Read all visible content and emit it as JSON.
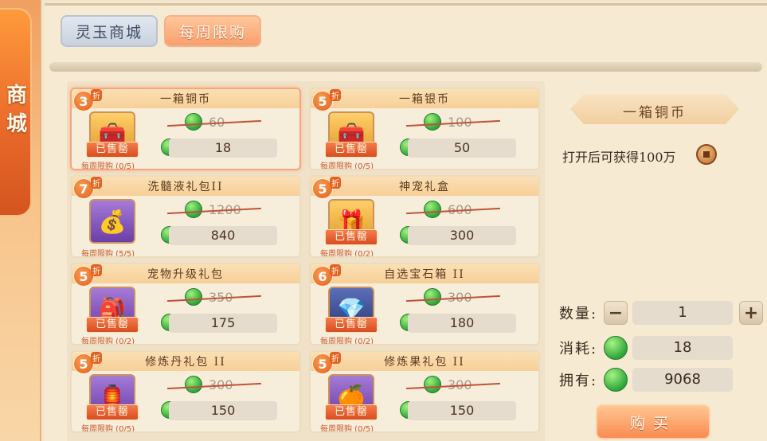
{
  "side_tab": {
    "label": "商城"
  },
  "tabs": [
    {
      "label": "灵玉商城",
      "active": false
    },
    {
      "label": "每周限购",
      "active": true
    }
  ],
  "sold_out_label": "已售罄",
  "items": [
    {
      "name": "一箱铜币",
      "discount": "3",
      "discount_unit": "折",
      "old_price": "60",
      "price": "18",
      "limit": "每周限购 (0/5)",
      "sold_out": true,
      "icon": "copper-chest-icon",
      "selected": true
    },
    {
      "name": "一箱银币",
      "discount": "5",
      "discount_unit": "折",
      "old_price": "100",
      "price": "50",
      "limit": "每周限购 (0/5)",
      "sold_out": true,
      "icon": "silver-chest-icon",
      "selected": false
    },
    {
      "name": "洗髓液礼包II",
      "discount": "7",
      "discount_unit": "折",
      "old_price": "1200",
      "price": "840",
      "limit": "每周限购 (5/5)",
      "sold_out": false,
      "icon": "potion-bag-icon",
      "selected": false
    },
    {
      "name": "神宠礼盒",
      "discount": "5",
      "discount_unit": "折",
      "old_price": "600",
      "price": "300",
      "limit": "每周限购 (0/2)",
      "sold_out": true,
      "icon": "pet-giftbox-icon",
      "selected": false
    },
    {
      "name": "宠物升级礼包",
      "discount": "5",
      "discount_unit": "折",
      "old_price": "350",
      "price": "175",
      "limit": "每周限购 (0/2)",
      "sold_out": true,
      "icon": "pet-upgrade-bag-icon",
      "selected": false
    },
    {
      "name": "自选宝石箱 II",
      "discount": "6",
      "discount_unit": "折",
      "old_price": "300",
      "price": "180",
      "limit": "每周限购 (0/2)",
      "sold_out": true,
      "icon": "gem-chest-icon",
      "selected": false
    },
    {
      "name": "修炼丹礼包 II",
      "discount": "5",
      "discount_unit": "折",
      "old_price": "300",
      "price": "150",
      "limit": "每周限购 (0/5)",
      "sold_out": true,
      "icon": "pill-bag-icon",
      "selected": false
    },
    {
      "name": "修炼果礼包 II",
      "discount": "5",
      "discount_unit": "折",
      "old_price": "300",
      "price": "150",
      "limit": "每周限购 (0/5)",
      "sold_out": true,
      "icon": "fruit-bag-icon",
      "selected": false
    }
  ],
  "detail": {
    "title": "一箱铜币",
    "description": "打开后可获得100万",
    "quantity_label": "数量:",
    "quantity": "1",
    "minus": "−",
    "plus": "+",
    "cost_label": "消耗:",
    "cost": "18",
    "owned_label": "拥有:",
    "owned": "9068",
    "buy_label": "购买"
  },
  "colors": {
    "accent": "#f98c52",
    "jade": "#2fa63b",
    "discount_badge": "#e4611f"
  }
}
